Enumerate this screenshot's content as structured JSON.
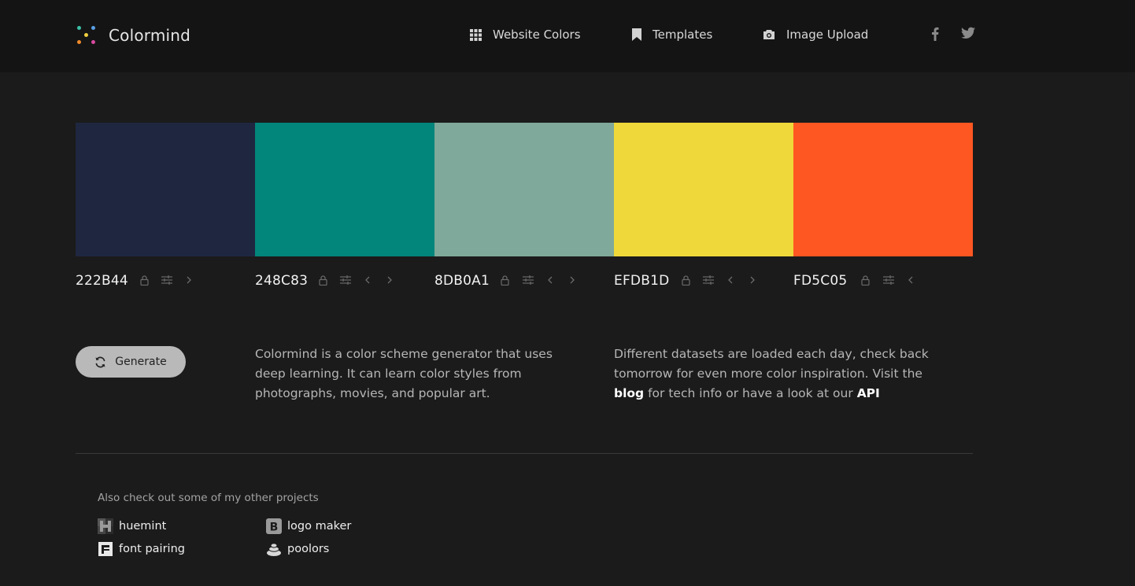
{
  "brand": {
    "name": "Colormind"
  },
  "nav": {
    "website_colors": "Website Colors",
    "templates": "Templates",
    "image_upload": "Image Upload"
  },
  "social": {
    "facebook_icon": "facebook-icon",
    "twitter_icon": "twitter-icon"
  },
  "palette": [
    {
      "code": "222B44",
      "color": "#1f2740"
    },
    {
      "code": "248C83",
      "color": "#02857a"
    },
    {
      "code": "8DB0A1",
      "color": "#7fa99a"
    },
    {
      "code": "EFDB1D",
      "color": "#efd93a"
    },
    {
      "code": "FD5C05",
      "color": "#fe5722"
    }
  ],
  "generate": {
    "label": "Generate"
  },
  "about": {
    "text": "Colormind is a color scheme generator that uses deep learning. It can learn color styles from photographs, movies, and popular art."
  },
  "datasets": {
    "text_1": "Different datasets are loaded each day, check back tomorrow for even more color inspiration. Visit the",
    "blog_link": "blog",
    "text_2": "for tech info or have a look at our",
    "api_link": "API"
  },
  "projects": {
    "heading": "Also check out some of my other projects",
    "items": [
      {
        "label": "huemint"
      },
      {
        "label": "logo maker"
      },
      {
        "label": "font pairing"
      },
      {
        "label": "poolors"
      }
    ]
  }
}
